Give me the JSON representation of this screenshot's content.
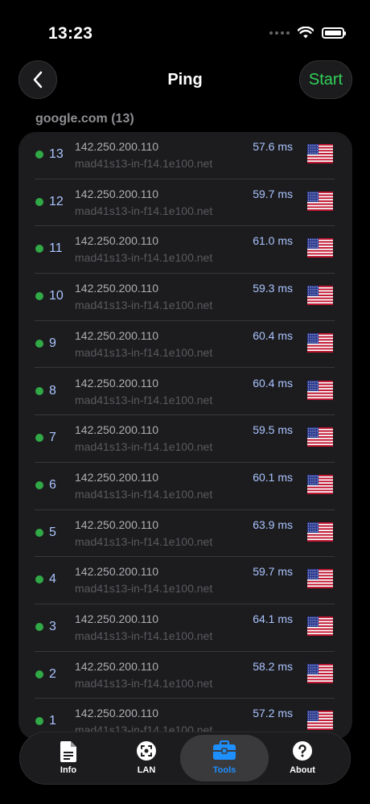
{
  "status_bar": {
    "time": "13:23"
  },
  "nav": {
    "title": "Ping",
    "start_label": "Start"
  },
  "section": {
    "header": "google.com (13)"
  },
  "rows": [
    {
      "seq": "13",
      "ip": "142.250.200.110",
      "host": "mad41s13-in-f14.1e100.net",
      "ms": "57.6 ms"
    },
    {
      "seq": "12",
      "ip": "142.250.200.110",
      "host": "mad41s13-in-f14.1e100.net",
      "ms": "59.7 ms"
    },
    {
      "seq": "11",
      "ip": "142.250.200.110",
      "host": "mad41s13-in-f14.1e100.net",
      "ms": "61.0 ms"
    },
    {
      "seq": "10",
      "ip": "142.250.200.110",
      "host": "mad41s13-in-f14.1e100.net",
      "ms": "59.3 ms"
    },
    {
      "seq": "9",
      "ip": "142.250.200.110",
      "host": "mad41s13-in-f14.1e100.net",
      "ms": "60.4 ms"
    },
    {
      "seq": "8",
      "ip": "142.250.200.110",
      "host": "mad41s13-in-f14.1e100.net",
      "ms": "60.4 ms"
    },
    {
      "seq": "7",
      "ip": "142.250.200.110",
      "host": "mad41s13-in-f14.1e100.net",
      "ms": "59.5 ms"
    },
    {
      "seq": "6",
      "ip": "142.250.200.110",
      "host": "mad41s13-in-f14.1e100.net",
      "ms": "60.1 ms"
    },
    {
      "seq": "5",
      "ip": "142.250.200.110",
      "host": "mad41s13-in-f14.1e100.net",
      "ms": "63.9 ms"
    },
    {
      "seq": "4",
      "ip": "142.250.200.110",
      "host": "mad41s13-in-f14.1e100.net",
      "ms": "59.7 ms"
    },
    {
      "seq": "3",
      "ip": "142.250.200.110",
      "host": "mad41s13-in-f14.1e100.net",
      "ms": "64.1 ms"
    },
    {
      "seq": "2",
      "ip": "142.250.200.110",
      "host": "mad41s13-in-f14.1e100.net",
      "ms": "58.2 ms"
    },
    {
      "seq": "1",
      "ip": "142.250.200.110",
      "host": "mad41s13-in-f14.1e100.net",
      "ms": "57.2 ms"
    }
  ],
  "tabs": [
    {
      "label": "Info",
      "icon": "document-icon"
    },
    {
      "label": "LAN",
      "icon": "lan-icon"
    },
    {
      "label": "Tools",
      "icon": "toolbox-icon",
      "active": true
    },
    {
      "label": "About",
      "icon": "question-icon"
    }
  ],
  "colors": {
    "accent_green": "#30d158",
    "status_green": "#30a946",
    "active_tab": "#1e8fff",
    "latency_text": "#aac4ff"
  }
}
